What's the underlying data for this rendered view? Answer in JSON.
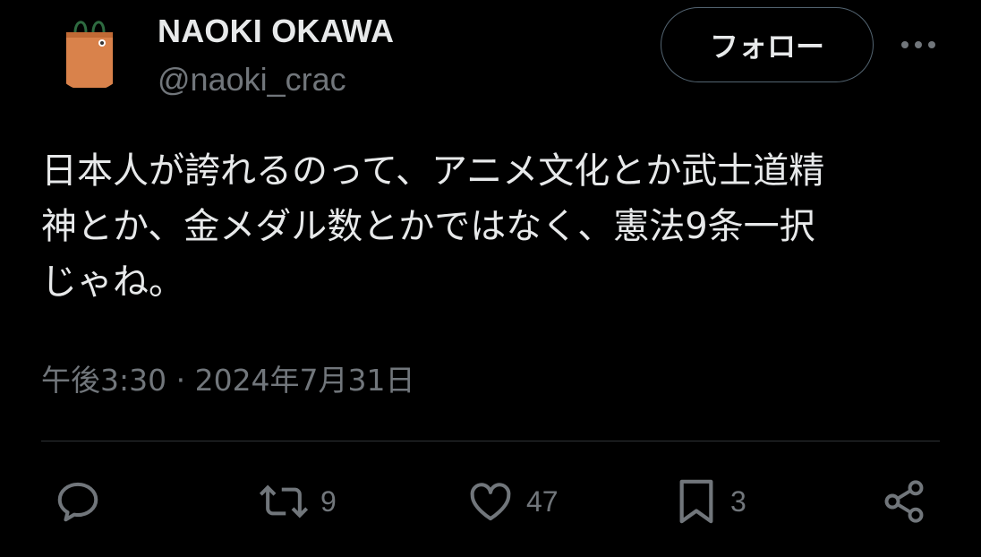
{
  "user": {
    "display_name": "NAOKI OKAWA",
    "handle": "@naoki_crac",
    "avatar": "shopping-bag-avatar"
  },
  "follow_label": "フォロー",
  "more_icon": "more-icon",
  "tweet": {
    "lines": [
      "日本人が誇れるのって、アニメ文化とか武士道精",
      "神とか、金メダル数とかではなく、憲法9条一択",
      "じゃね。"
    ]
  },
  "meta": {
    "timestamp": "午後3:30 · 2024年7月31日"
  },
  "actions": {
    "reply": {
      "icon": "reply-icon",
      "count": ""
    },
    "retweet": {
      "icon": "retweet-icon",
      "count": "9"
    },
    "like": {
      "icon": "heart-icon",
      "count": "47"
    },
    "bookmark": {
      "icon": "bookmark-icon",
      "count": "3"
    },
    "share": {
      "icon": "share-icon"
    }
  },
  "colors": {
    "background": "#000000",
    "text": "#e7e9ea",
    "secondary": "#71767b",
    "border": "#536471",
    "divider": "#2f3336",
    "avatar_bag": "#d9824b"
  }
}
